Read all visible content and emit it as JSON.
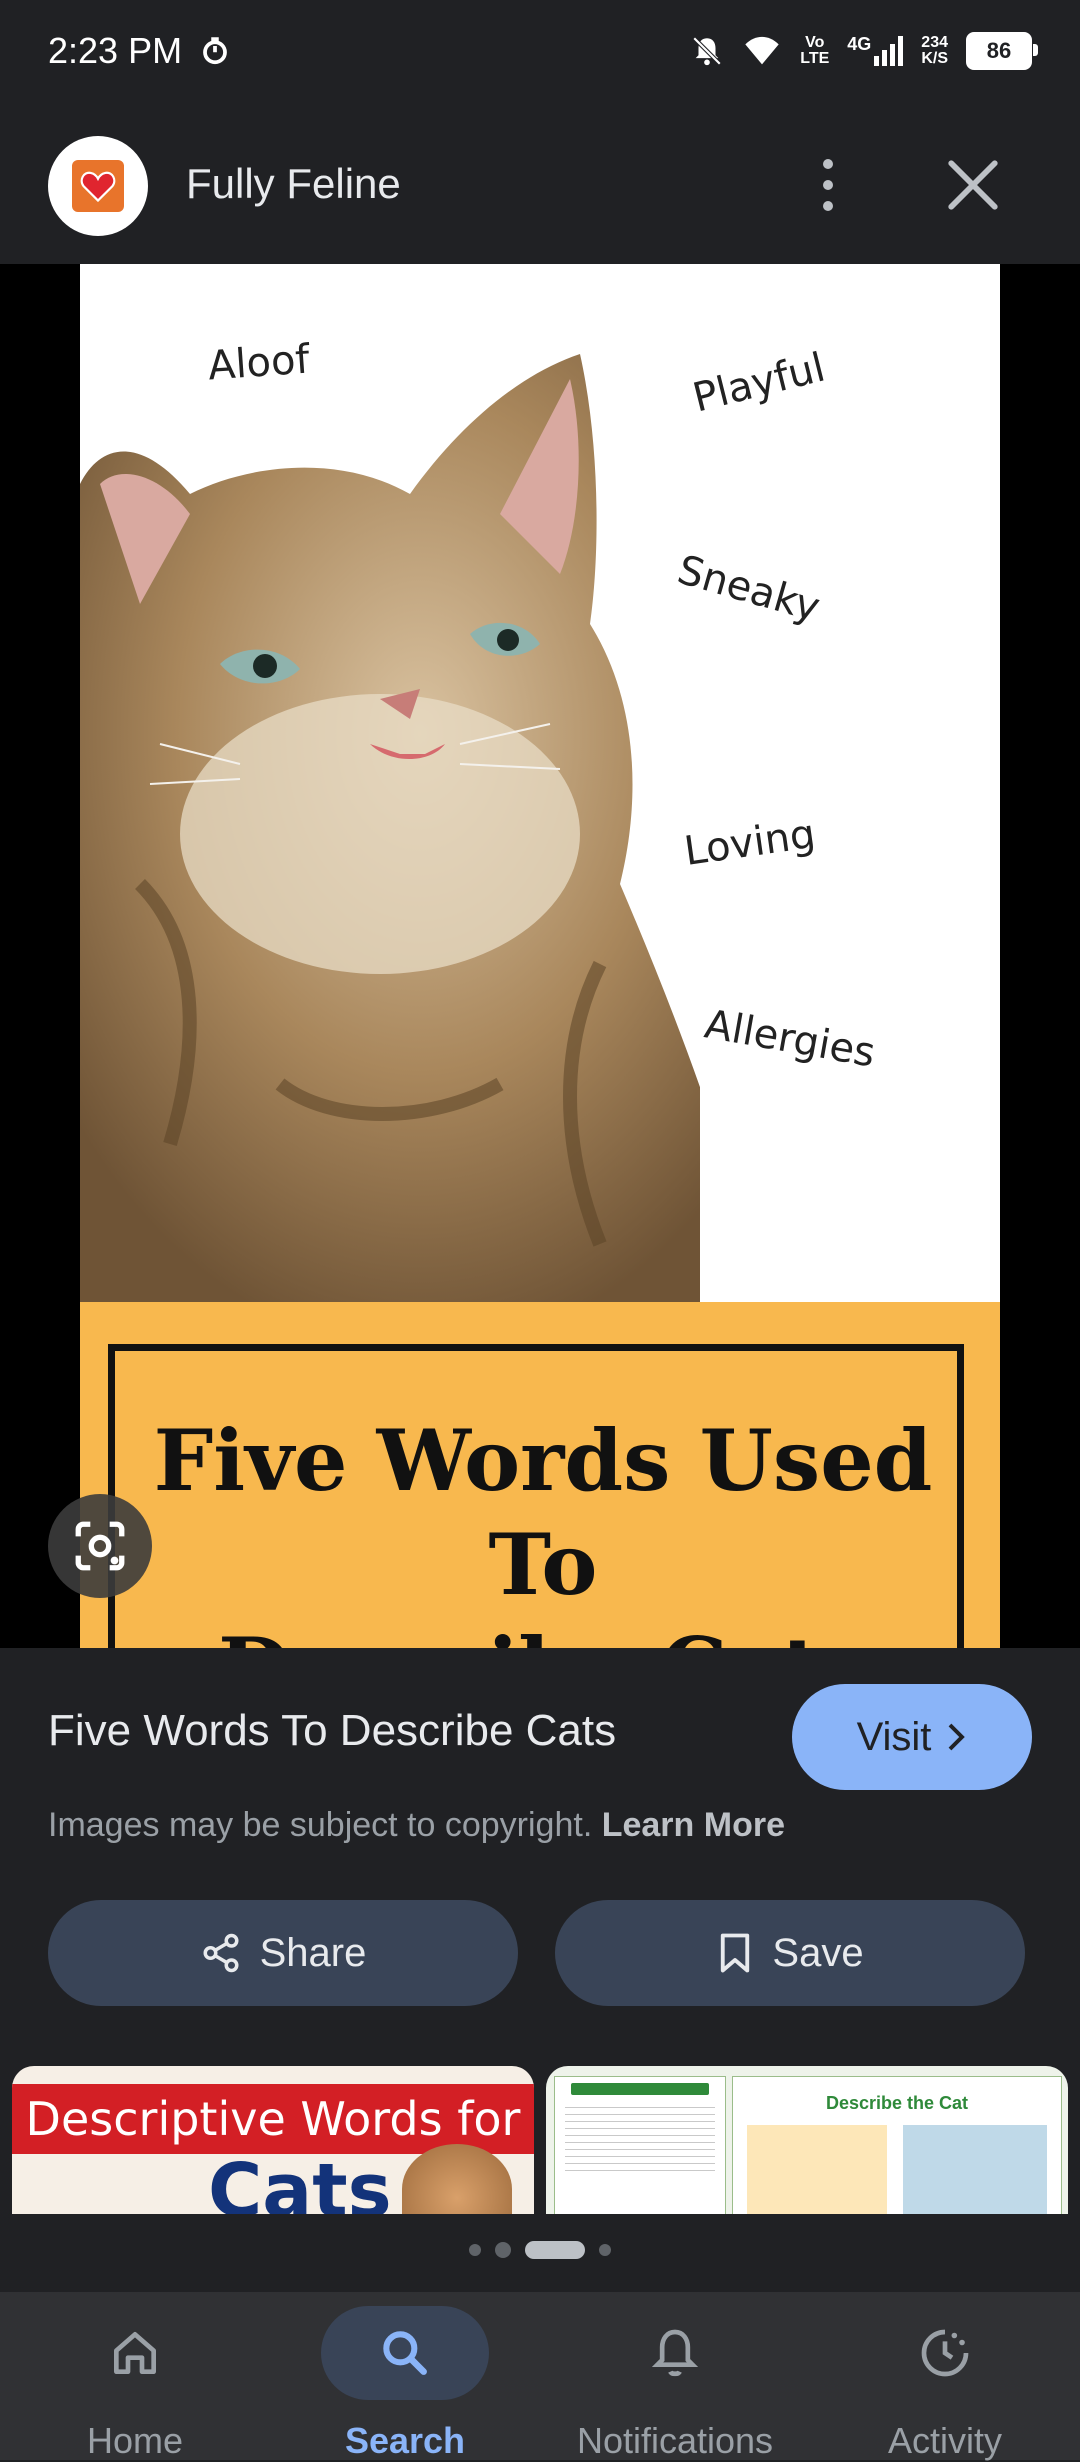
{
  "status_bar": {
    "time": "2:23 PM",
    "volte_top": "Vo",
    "volte_bottom": "LTE",
    "network": "4G",
    "speed_top": "234",
    "speed_bottom": "K/S",
    "battery": "86"
  },
  "header": {
    "site_name": "Fully Feline"
  },
  "image": {
    "words": [
      "Aloof",
      "Playful",
      "Sneaky",
      "Loving",
      "Allergies"
    ],
    "banner_line1": "Five Words Used To",
    "banner_line2": "Describe Cats"
  },
  "result": {
    "title": "Five Words To Describe Cats",
    "visit_label": "Visit",
    "copyright_text": "Images may be subject to copyright.",
    "learn_more": "Learn More",
    "share_label": "Share",
    "save_label": "Save"
  },
  "related": [
    {
      "line1": "Descriptive Words for",
      "line2": "Cats"
    },
    {
      "title": "Describe the Cat"
    }
  ],
  "nav": [
    {
      "label": "Home",
      "icon": "home-icon"
    },
    {
      "label": "Search",
      "icon": "search-icon",
      "active": true
    },
    {
      "label": "Notifications",
      "icon": "bell-icon"
    },
    {
      "label": "Activity",
      "icon": "activity-icon"
    }
  ],
  "colors": {
    "background": "#202124",
    "accent": "#8ab4f8",
    "button": "#394457",
    "banner": "#f8b84e"
  }
}
